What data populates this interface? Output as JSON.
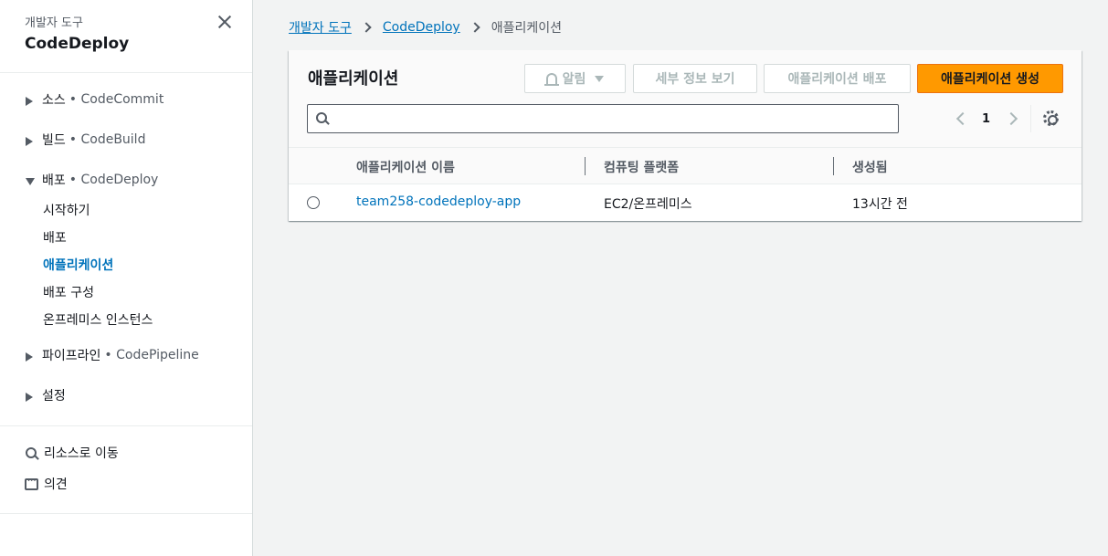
{
  "sidebar": {
    "super_title": "개발자 도구",
    "title": "CodeDeploy",
    "sections": [
      {
        "label": "소스",
        "service": "• CodeCommit"
      },
      {
        "label": "빌드",
        "service": "• CodeBuild"
      },
      {
        "label": "배포",
        "service": "• CodeDeploy"
      },
      {
        "label": "파이프라인",
        "service": "• CodePipeline"
      },
      {
        "label": "설정",
        "service": ""
      }
    ],
    "deploy_items": [
      "시작하기",
      "배포",
      "애플리케이션",
      "배포 구성",
      "온프레미스 인스턴스"
    ],
    "active_item": "애플리케이션",
    "links": {
      "goto_resource": "리소스로 이동",
      "feedback": "의견"
    }
  },
  "breadcrumb": {
    "items": [
      "개발자 도구",
      "CodeDeploy"
    ],
    "current": "애플리케이션"
  },
  "panel": {
    "title": "애플리케이션",
    "buttons": {
      "notify": "알림",
      "view_details": "세부 정보 보기",
      "deploy_app": "애플리케이션 배포",
      "create_app": "애플리케이션 생성"
    },
    "search_value": "",
    "page": "1",
    "columns": [
      "애플리케이션 이름",
      "컴퓨팅 플랫폼",
      "생성됨"
    ],
    "rows": [
      {
        "name": "team258-codedeploy-app",
        "platform": "EC2/온프레미스",
        "created": "13시간 전"
      }
    ]
  },
  "colors": {
    "accent": "#ff9900",
    "link": "#0073bb",
    "text": "#16191f",
    "muted": "#545b64",
    "background": "#f2f3f3"
  }
}
